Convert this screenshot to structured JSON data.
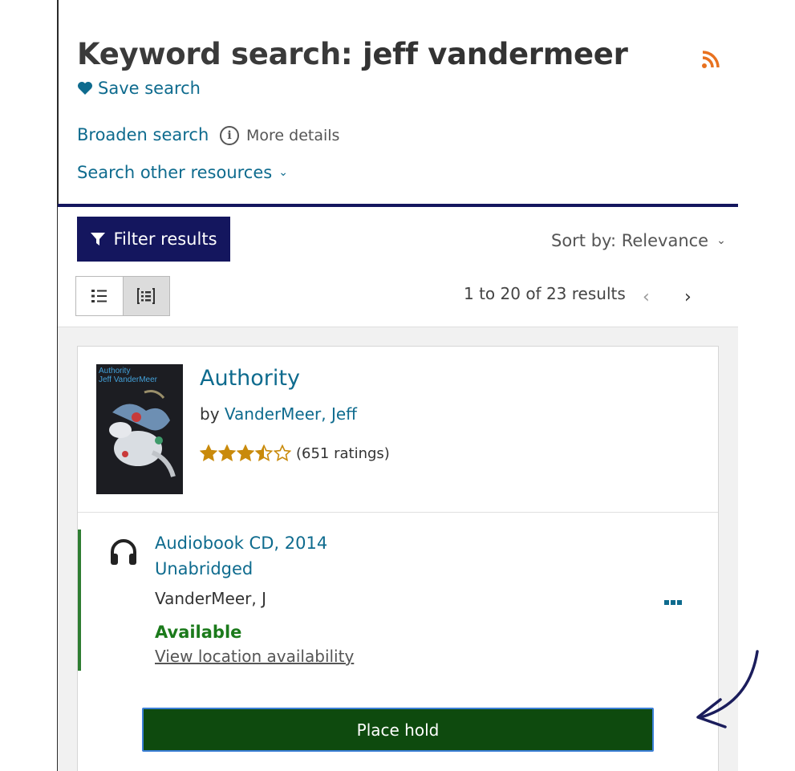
{
  "search": {
    "title_prefix": "Keyword search: ",
    "title_query": "jeff vandermeer",
    "save_label": "Save search",
    "broaden_label": "Broaden search",
    "more_details_label": "More details",
    "other_resources_label": "Search other resources"
  },
  "toolbar": {
    "filter_label": "Filter results",
    "sort_label": "Sort by: Relevance",
    "results_count": "1 to 20 of 23 results"
  },
  "result": {
    "cover_text": "Authority\nJeff VanderMeer",
    "title": "Authority",
    "by_prefix": "by ",
    "author": "VanderMeer, Jeff",
    "rating_value": 3.5,
    "rating_max": 5,
    "rating_text": "(651 ratings)",
    "edition": {
      "format": "Audiobook CD, 2014",
      "abridgement": "Unabridged",
      "author": "VanderMeer, J",
      "availability": "Available",
      "location_link": "View location availability"
    },
    "hold_label": "Place hold"
  },
  "colors": {
    "link": "#0e6b8e",
    "navy": "#14165e",
    "available": "#1b7a1b",
    "hold_button": "#0e4a0e",
    "star": "#c98a0b",
    "rss": "#e8711f"
  },
  "icons": [
    "heart-icon",
    "info-icon",
    "chevron-down-icon",
    "filter-icon",
    "list-view-icon",
    "detail-view-icon",
    "chevron-left-icon",
    "chevron-right-icon",
    "headphones-icon",
    "more-icon",
    "rss-icon"
  ]
}
